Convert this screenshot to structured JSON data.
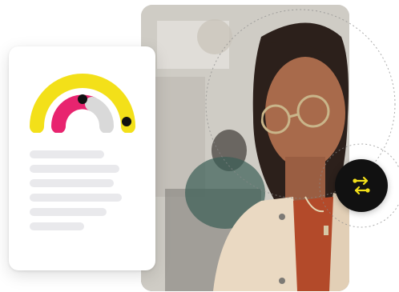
{
  "colors": {
    "gauge_outer": "#f3e019",
    "gauge_middle": "#e8246f",
    "gauge_inner": "#d9d9d9",
    "gauge_dot": "#111111",
    "badge_background": "#111111",
    "badge_icon": "#f3e019",
    "doc_line": "#e9e9ec"
  },
  "gauge": {
    "segments": [
      "outer-ring",
      "middle-ring",
      "inner-ring"
    ]
  },
  "icons": {
    "badge": "swap-arrows-icon"
  }
}
